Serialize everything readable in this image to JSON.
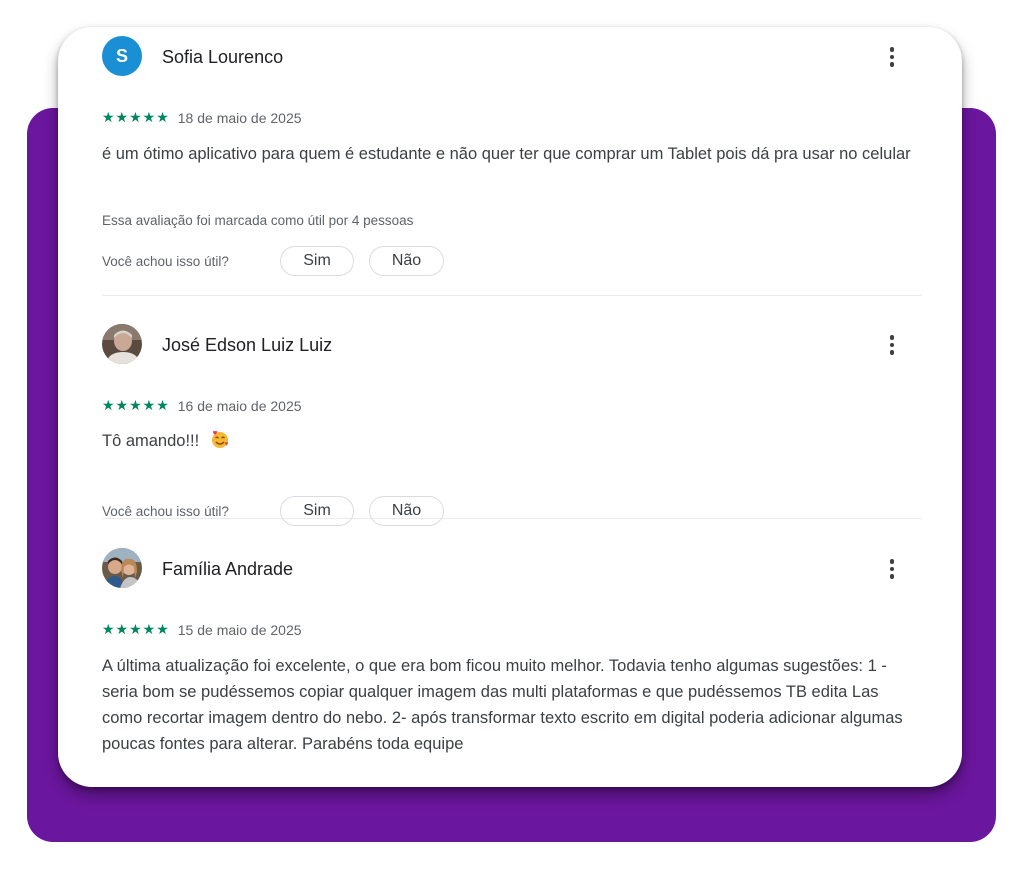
{
  "colors": {
    "background_panel": "#6b169e",
    "star": "#01875f",
    "avatar_letter_bg": "#1a8fd6"
  },
  "helpful_question": "Você achou isso útil?",
  "yes_label": "Sim",
  "no_label": "Não",
  "reviews": [
    {
      "author": "Sofia Lourenco",
      "avatar_letter": "S",
      "stars": "★★★★★",
      "rating": 5,
      "date": "18 de maio de 2025",
      "text": "é um ótimo aplicativo para quem é estudante e não quer ter que comprar um Tablet pois dá pra usar no celular",
      "helpful_count": "Essa avaliação foi marcada como útil por 4 pessoas"
    },
    {
      "author": "José Edson Luiz Luiz",
      "stars": "★★★★★",
      "rating": 5,
      "date": "16 de maio de 2025",
      "text": "Tô amando!!!",
      "emoji": "smiling-face-with-hearts-icon"
    },
    {
      "author": "Família Andrade",
      "stars": "★★★★★",
      "rating": 5,
      "date": "15 de maio de 2025",
      "text": "A última atualização foi excelente, o que era bom ficou muito melhor. Todavia tenho algumas sugestões: 1 - seria bom se pudéssemos copiar qualquer imagem das multi plataformas e que pudéssemos TB edita Las como recortar imagem dentro do nebo. 2- após transformar texto escrito em digital poderia adicionar algumas poucas fontes para alterar. Parabéns toda equipe"
    }
  ]
}
